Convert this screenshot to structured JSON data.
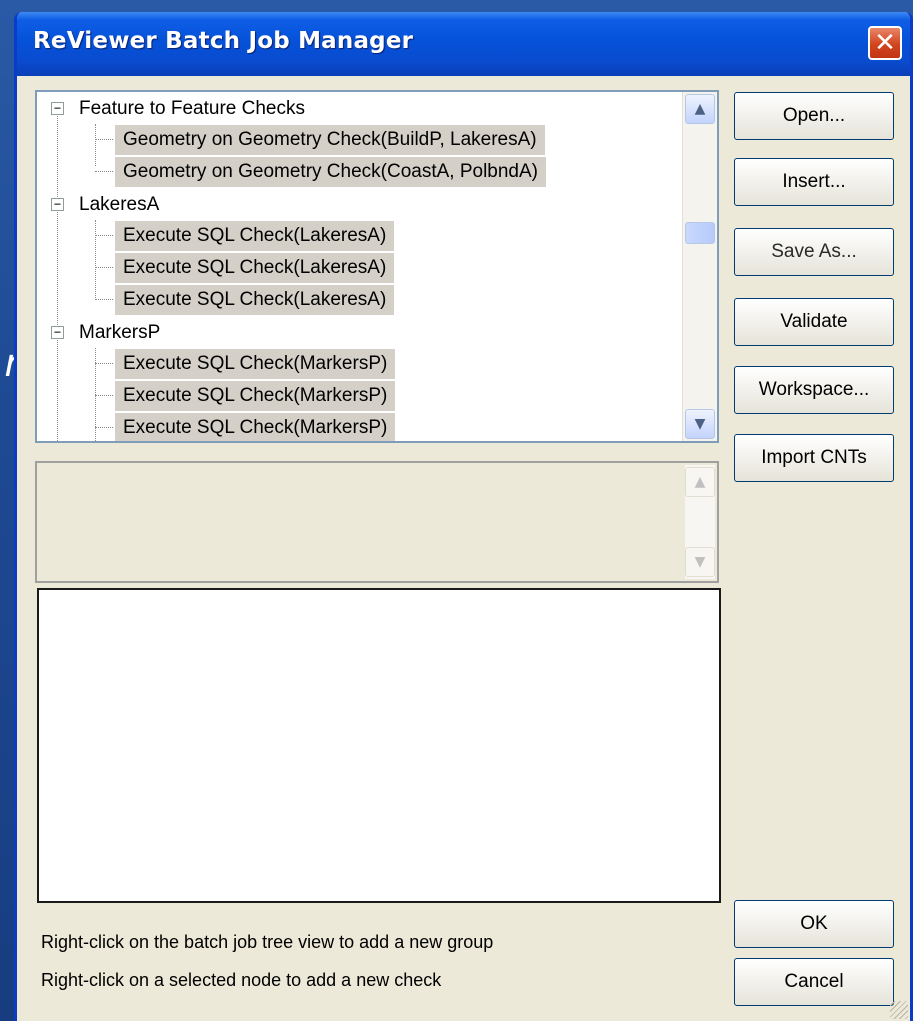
{
  "background": {
    "partial_char": "r"
  },
  "window": {
    "title": "ReViewer Batch Job Manager",
    "close_glyph": "✕",
    "title_color": "#0552d8",
    "face_color": "#ece9d8"
  },
  "tree": {
    "groups": [
      {
        "label": "Feature to Feature Checks",
        "expander": "−",
        "children": [
          "Geometry on Geometry Check(BuildP, LakeresA)",
          "Geometry on Geometry Check(CoastA, PolbndA)"
        ]
      },
      {
        "label": "LakeresA",
        "expander": "−",
        "children": [
          "Execute SQL Check(LakeresA)",
          "Execute SQL Check(LakeresA)",
          "Execute SQL Check(LakeresA)"
        ]
      },
      {
        "label": "MarkersP",
        "expander": "−",
        "children": [
          "Execute SQL Check(MarkersP)",
          "Execute SQL Check(MarkersP)",
          "Execute SQL Check(MarkersP)"
        ]
      }
    ],
    "scroll_up_glyph": "▲",
    "scroll_down_glyph": "▼"
  },
  "buttons": {
    "open": "Open...",
    "insert": "Insert...",
    "save_as": "Save As...",
    "validate": "Validate",
    "workspace": "Workspace...",
    "import_cnts": "Import CNTs",
    "ok": "OK",
    "cancel": "Cancel"
  },
  "hints": {
    "line1": "Right-click on the batch job tree  view to add a new group",
    "line2": "Right-click on a selected node to add a new check"
  },
  "icons": {
    "close": "close-icon",
    "expander": "minus-box-icon",
    "scroll_up": "chevron-up-icon",
    "scroll_down": "chevron-down-icon",
    "grip": "resize-grip-icon"
  }
}
